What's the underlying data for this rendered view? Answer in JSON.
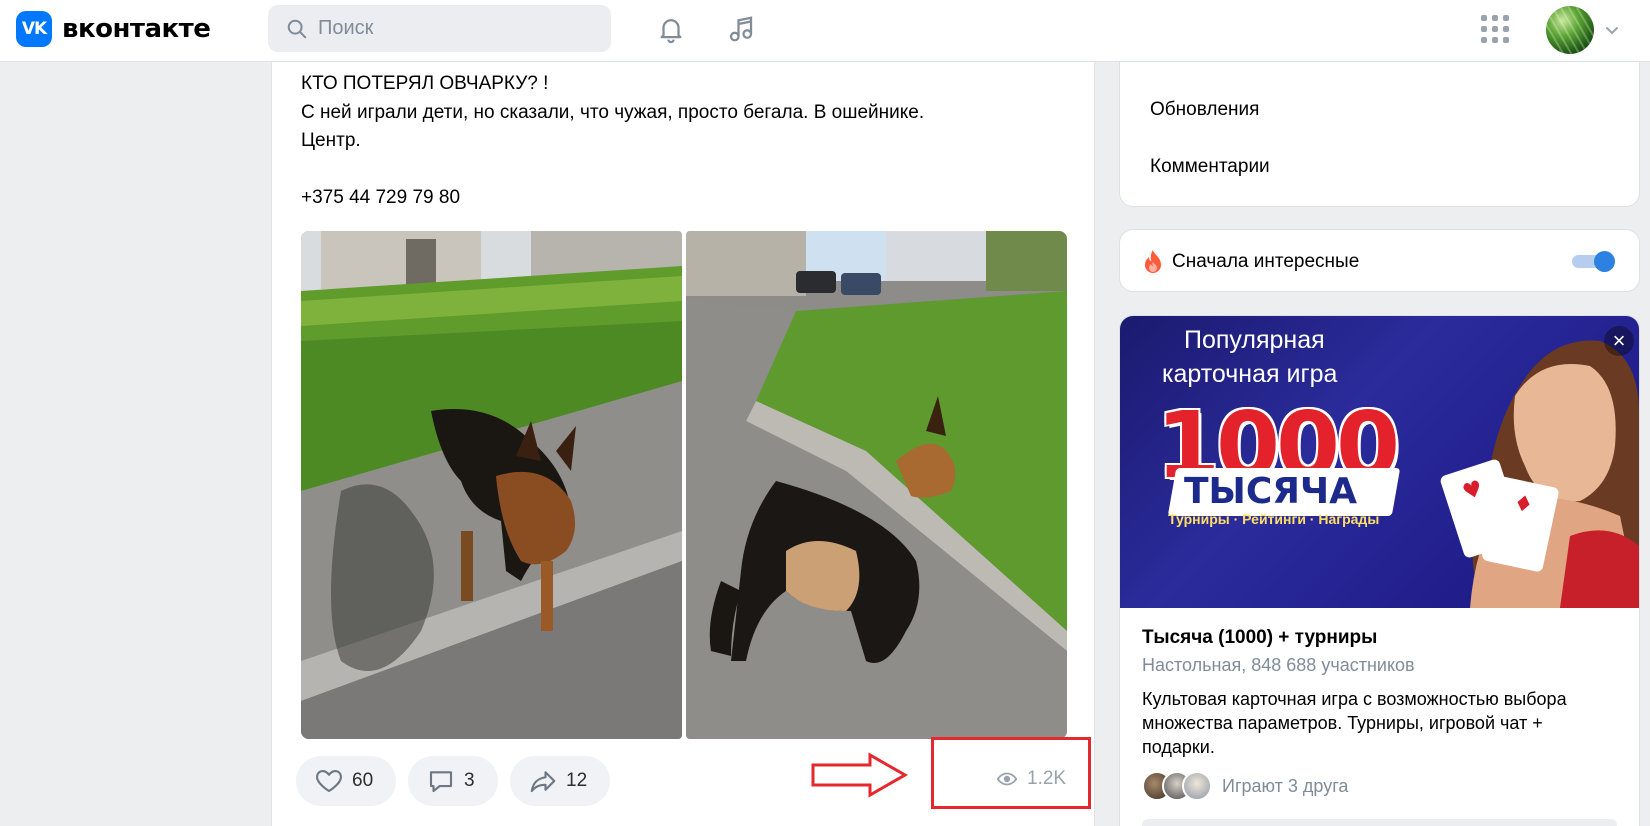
{
  "header": {
    "logo_text": "вконтакте",
    "logo_mark": "VK",
    "search_placeholder": "Поиск",
    "icons": [
      "search-icon",
      "bell-icon",
      "music-icon",
      "apps-grid-icon",
      "chevron-down-icon"
    ]
  },
  "post": {
    "text_lines": [
      "КТО ПОТЕРЯЛ ОВЧАРКУ? !",
      "С ней играли дети, но сказали, что чужая, просто бегала. В ошейнике.",
      "Центр.",
      "",
      "+375 44 729 79 80"
    ],
    "actions": {
      "likes": "60",
      "comments": "3",
      "shares": "12"
    },
    "views": "1.2K",
    "highlight_color": "#e5282d"
  },
  "sidebar": {
    "menu": [
      "Обновления",
      "Комментарии"
    ],
    "sort_label": "Сначала интересные",
    "sort_enabled": true
  },
  "ad": {
    "banner": {
      "line1": "Популярная",
      "line2": "карточная игра",
      "number": "1000",
      "word": "ТЫСЯЧА",
      "tags": "Турниры · Рейтинги · Награды"
    },
    "name": "Тысяча (1000) + турниры",
    "meta": "Настольная, 848 688 участников",
    "description_lines": [
      "Культовая карточная игра с возможностью выбора",
      "множества параметров. Турниры, игровой чат +",
      "подарки."
    ],
    "friends_text": "Играют 3 друга"
  },
  "colors": {
    "accent": "#0077ff",
    "background": "#edeef0",
    "secondary_text": "#818c99"
  }
}
